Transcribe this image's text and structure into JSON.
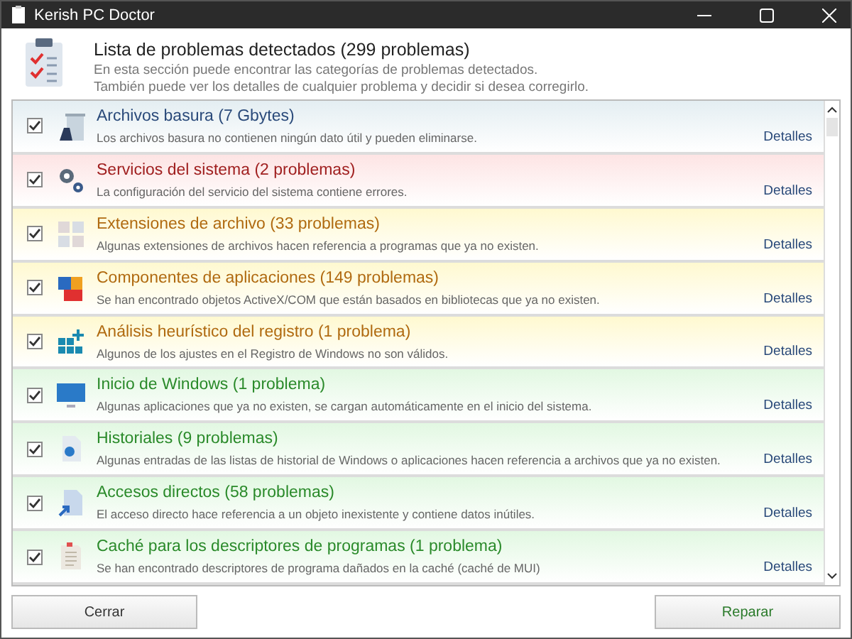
{
  "window": {
    "title": "Kerish PC Doctor"
  },
  "header": {
    "title": "Lista de problemas detectados (299 problemas)",
    "lines": [
      "En esta sección puede encontrar las categorías de problemas detectados.",
      "También puede ver los detalles de cualquier problema y decidir si desea corregirlo."
    ]
  },
  "categories": [
    {
      "title": "Archivos basura (7 Gbytes)",
      "description": "Los archivos basura no contienen ningún dato útil y pueden eliminarse.",
      "link": "Detalles",
      "kind": "info",
      "checked": true
    },
    {
      "title": "Servicios del sistema (2 problemas)",
      "description": "La configuración del servicio del sistema contiene errores.",
      "link": "Detalles",
      "kind": "error",
      "checked": true
    },
    {
      "title": "Extensiones de archivo (33 problemas)",
      "description": "Algunas extensiones de archivos hacen referencia a programas que ya no existen.",
      "link": "Detalles",
      "kind": "warning",
      "checked": true
    },
    {
      "title": "Componentes de aplicaciones (149 problemas)",
      "description": "Se han encontrado objetos ActiveX/COM que están basados en bibliotecas que ya no existen.",
      "link": "Detalles",
      "kind": "warning",
      "checked": true
    },
    {
      "title": "Análisis heurístico del registro (1 problema)",
      "description": "Algunos de los ajustes en el Registro de Windows no son válidos.",
      "link": "Detalles",
      "kind": "warning",
      "checked": true
    },
    {
      "title": "Inicio de Windows (1 problema)",
      "description": "Algunas aplicaciones que ya no existen, se cargan automáticamente en el inicio del sistema.",
      "link": "Detalles",
      "kind": "ok",
      "checked": true
    },
    {
      "title": "Historiales (9 problemas)",
      "description": "Algunas entradas de las listas de historial de Windows o aplicaciones hacen referencia a archivos que ya no existen.",
      "link": "Detalles",
      "kind": "ok",
      "checked": true
    },
    {
      "title": "Accesos directos (58 problemas)",
      "description": "El acceso directo hace referencia a un objeto inexistente y contiene datos inútiles.",
      "link": "Detalles",
      "kind": "ok",
      "checked": true
    },
    {
      "title": "Caché para los descriptores de programas (1 problema)",
      "description": "Se han encontrado descriptores de programa dañados en la caché (caché de MUI)",
      "link": "Detalles",
      "kind": "ok",
      "checked": true
    }
  ],
  "buttons": {
    "close": "Cerrar",
    "repair": "Reparar"
  }
}
